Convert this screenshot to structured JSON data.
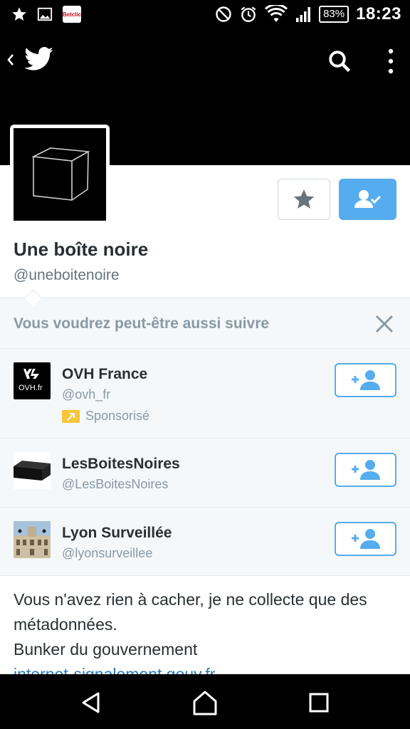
{
  "status_bar": {
    "time": "18:23",
    "battery": "83%",
    "left_icons": [
      "star-icon",
      "image-icon",
      "betclic-app-icon"
    ],
    "right_icons": [
      "do-not-disturb-icon",
      "alarm-icon",
      "wifi-icon",
      "signal-icon",
      "battery-icon"
    ],
    "betclic_label": "Betclic"
  },
  "app_bar": {
    "icons": [
      "back-chevron-icon",
      "twitter-bird-icon",
      "search-icon",
      "overflow-menu-icon"
    ]
  },
  "profile": {
    "name": "Une boîte noire",
    "handle": "@uneboitenoire"
  },
  "suggestions": {
    "title": "Vous voudrez peut-être aussi suivre",
    "items": [
      {
        "name": "OVH France",
        "handle": "@ovh_fr",
        "promoted": "Sponsorisé",
        "logo_text": "OVH.fr"
      },
      {
        "name": "LesBoitesNoires",
        "handle": "@LesBoitesNoires"
      },
      {
        "name": "Lyon Surveillée",
        "handle": "@lyonsurveillee"
      }
    ]
  },
  "bio": {
    "line1": "Vous n'avez rien à cacher, je ne collecte que des métadonnées.",
    "line2": "Bunker du gouvernement",
    "link": "internet-signalement.gouv.fr"
  },
  "colors": {
    "twitter_blue": "#55acee",
    "link_blue": "#2b7bb9",
    "promoted_yellow": "#f8c53b",
    "muted_text": "#8899a6"
  },
  "nav_bar": {
    "icons": [
      "back-triangle-icon",
      "home-icon",
      "recents-square-icon"
    ]
  }
}
